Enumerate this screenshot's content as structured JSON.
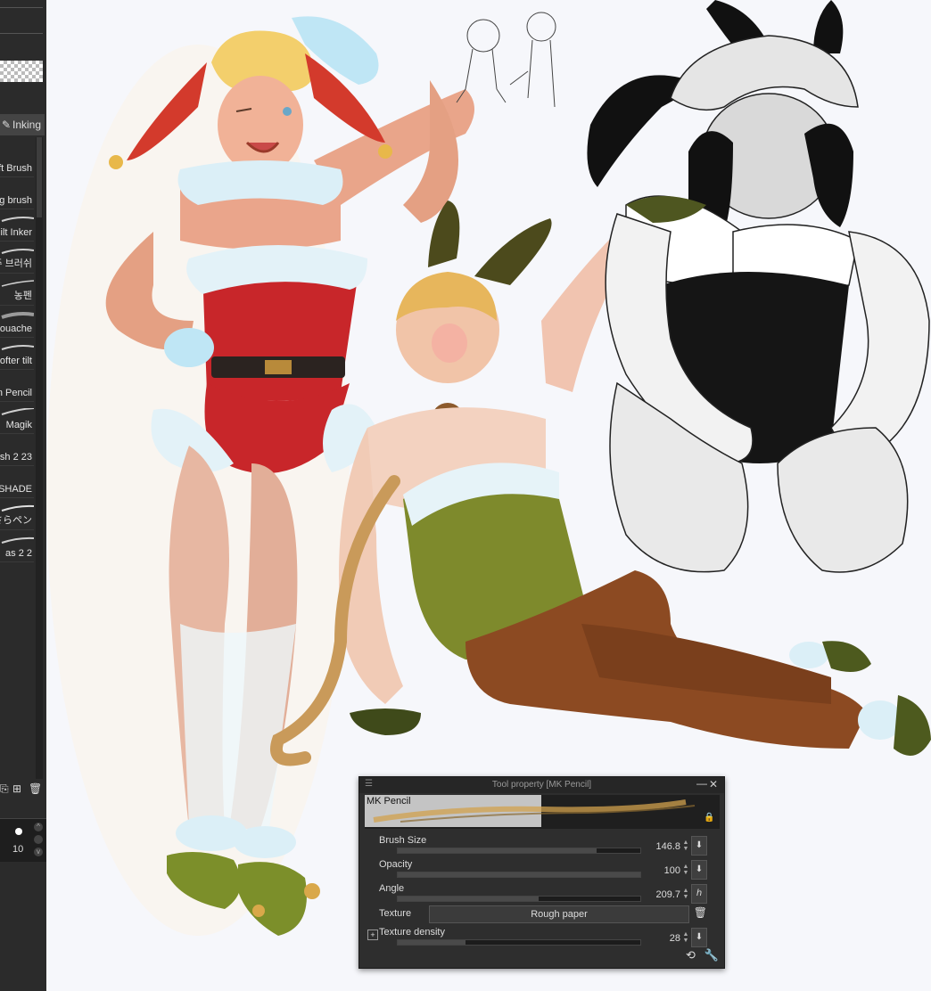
{
  "brush_panel": {
    "tab_label": "Inking",
    "items": [
      {
        "label": "ft Brush"
      },
      {
        "label": "g brush"
      },
      {
        "label": "ilt Inker"
      },
      {
        "label": "주 브러쉬"
      },
      {
        "label": "농펜"
      },
      {
        "label": "ouache"
      },
      {
        "label": "ofter tilt"
      },
      {
        "label": "n Pencil"
      },
      {
        "label": "Magik"
      },
      {
        "label": "sh 2 23"
      },
      {
        "label": "SHADE"
      },
      {
        "label": "さらペン"
      },
      {
        "label": "as 2 2"
      }
    ],
    "size_value": "10"
  },
  "tool_property": {
    "title": "Tool property [MK Pencil]",
    "brush_name": "MK Pencil",
    "rows": [
      {
        "label": "Brush Size",
        "value": "146.8",
        "fill": 0.82
      },
      {
        "label": "Opacity",
        "value": "100",
        "fill": 1.0
      },
      {
        "label": "Angle",
        "value": "209.7",
        "fill": 0.58
      }
    ],
    "texture": {
      "label": "Texture",
      "value": "Rough paper"
    },
    "texture_density": {
      "label": "Texture density",
      "value": "28",
      "fill": 0.28
    }
  },
  "colors": {
    "panel_bg": "#2e2e2e",
    "canvas_bg": "#f6f7fb",
    "santa_red": "#c8262a",
    "bunny_green": "#7e8a2c",
    "bunny_tights": "#8c4a22"
  }
}
